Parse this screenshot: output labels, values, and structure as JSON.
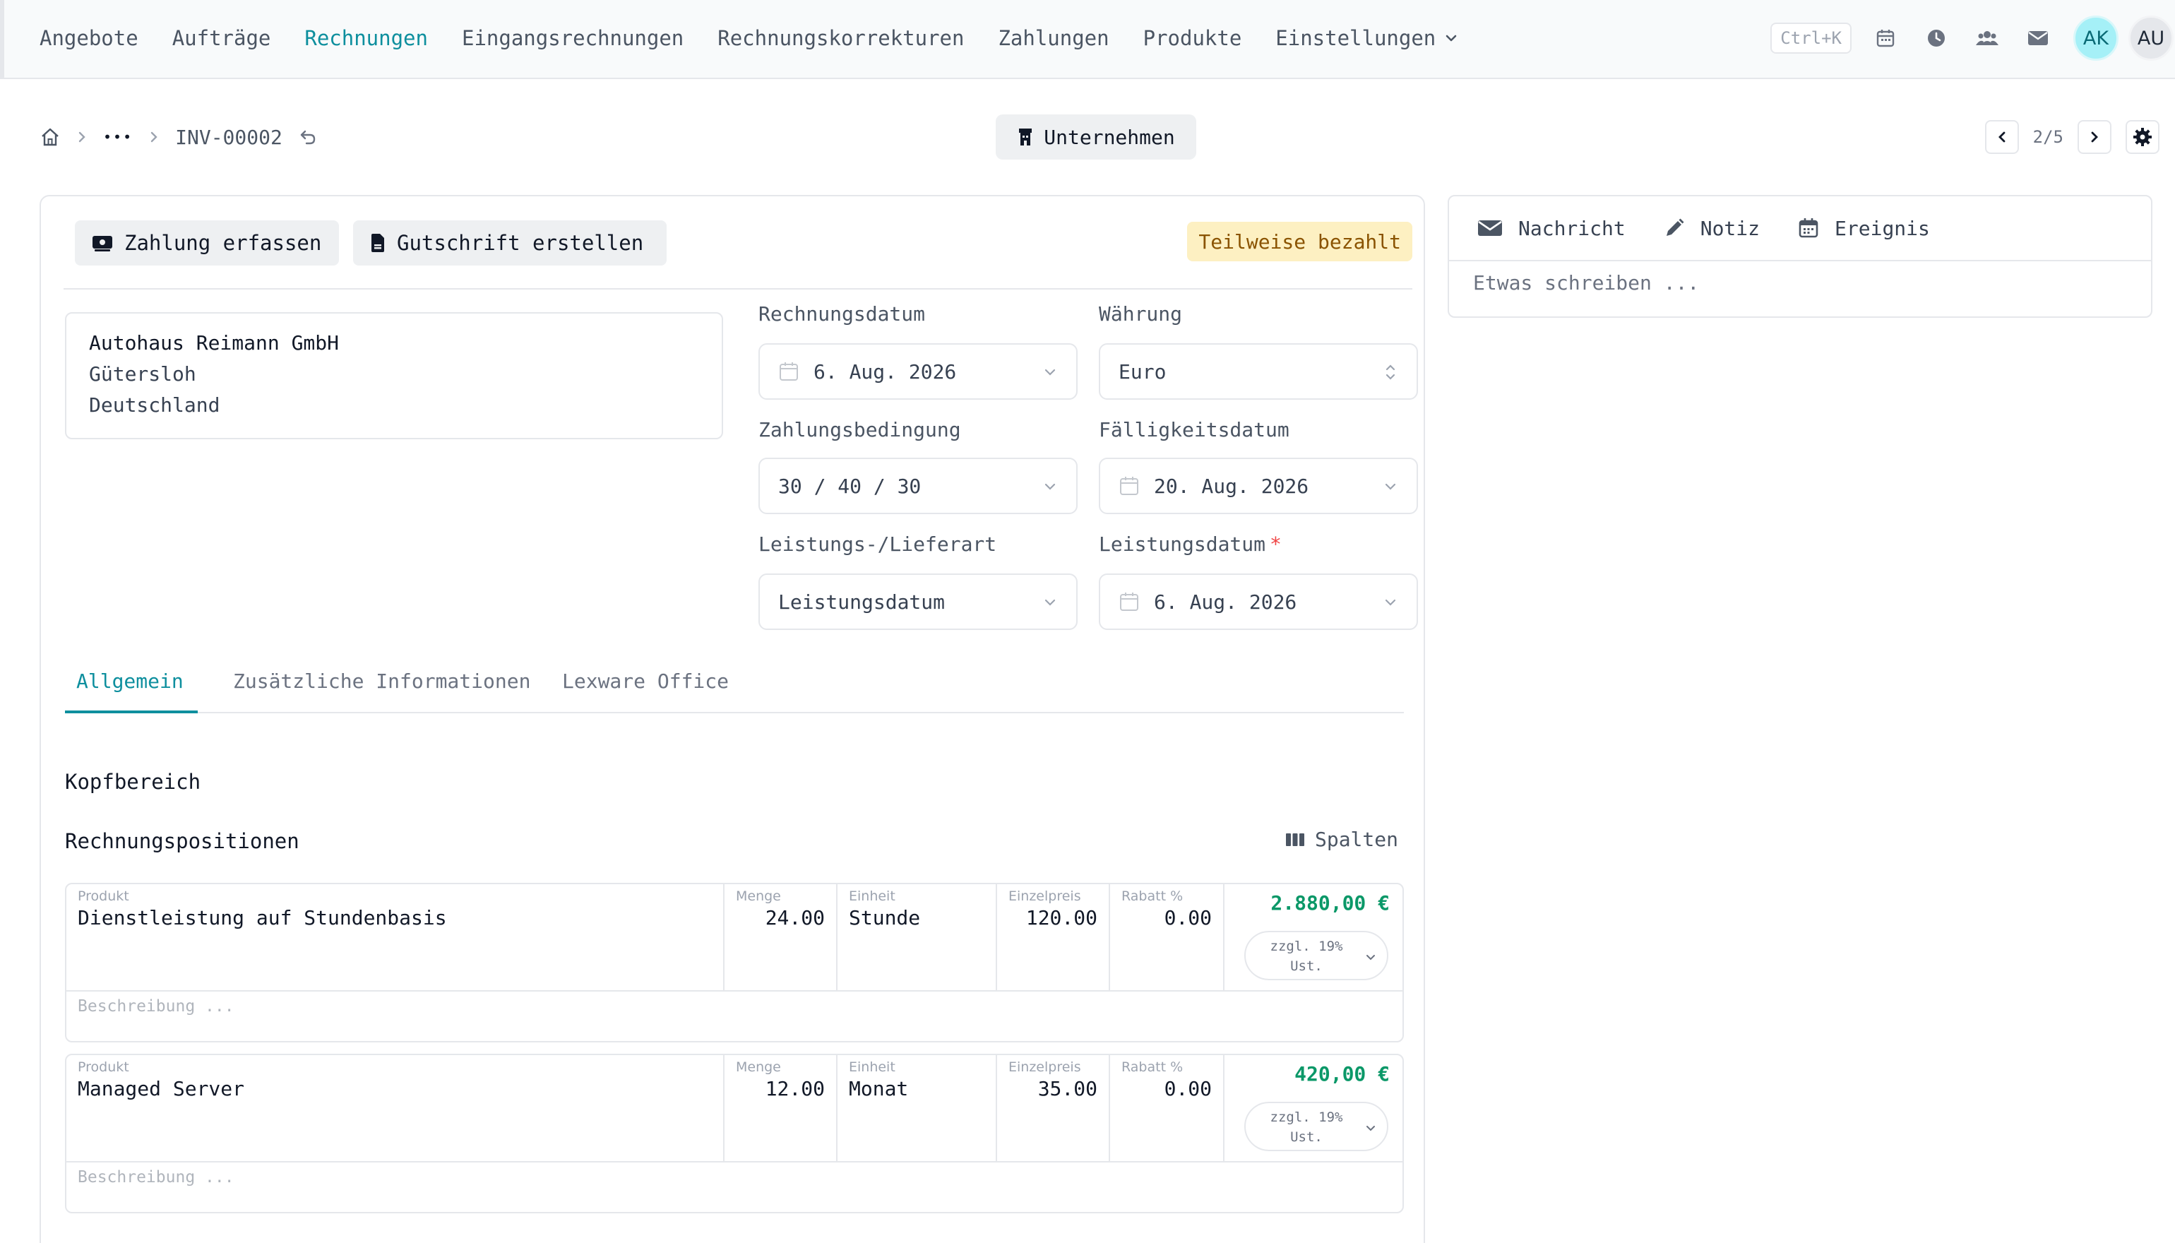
{
  "nav": {
    "items": [
      "Angebote",
      "Aufträge",
      "Rechnungen",
      "Eingangsrechnungen",
      "Rechnungskorrekturen",
      "Zahlungen",
      "Produkte",
      "Einstellungen"
    ],
    "active_index": 2,
    "shortcut": "Ctrl+K",
    "avatars": [
      "AK",
      "AU"
    ],
    "icons": [
      "calendar-icon",
      "clock-icon",
      "users-icon",
      "mail-icon"
    ]
  },
  "breadcrumb": {
    "ellipsis": "•••",
    "current": "INV-00002"
  },
  "company_button": {
    "label": "Unternehmen"
  },
  "pager": {
    "text": "2/5"
  },
  "actions": {
    "record_payment": "Zahlung erfassen",
    "create_credit": "Gutschrift erstellen",
    "status": "Teilweise bezahlt"
  },
  "address": {
    "name": "Autohaus Reimann GmbH",
    "city": "Gütersloh",
    "country": "Deutschland"
  },
  "fields": {
    "invoice_date_label": "Rechnungsdatum",
    "invoice_date": "6. Aug. 2026",
    "currency_label": "Währung",
    "currency": "Euro",
    "payment_terms_label": "Zahlungsbedingung",
    "payment_terms": "30 / 40 / 30",
    "due_date_label": "Fälligkeitsdatum",
    "due_date": "20. Aug. 2026",
    "delivery_type_label": "Leistungs-/Lieferart",
    "delivery_type": "Leistungsdatum",
    "service_date_label": "Leistungsdatum",
    "service_date_required": "*",
    "service_date": "6. Aug. 2026"
  },
  "tabs": [
    "Allgemein",
    "Zusätzliche Informationen",
    "Lexware Office"
  ],
  "sections": {
    "header": "Kopfbereich",
    "positions": "Rechnungspositionen",
    "columns_button": "Spalten"
  },
  "line_headers": {
    "product": "Produkt",
    "qty": "Menge",
    "unit": "Einheit",
    "price": "Einzelpreis",
    "discount": "Rabatt %"
  },
  "lines": [
    {
      "product": "Dienstleistung auf Stundenbasis",
      "qty": "24.00",
      "unit": "Stunde",
      "price": "120.00",
      "discount": "0.00",
      "amount": "2.880,00 €",
      "tax_line1": "zzgl. 19%",
      "tax_line2": "Ust.",
      "desc_placeholder": "Beschreibung ..."
    },
    {
      "product": "Managed Server",
      "qty": "12.00",
      "unit": "Monat",
      "price": "35.00",
      "discount": "0.00",
      "amount": "420,00 €",
      "tax_line1": "zzgl. 19%",
      "tax_line2": "Ust.",
      "desc_placeholder": "Beschreibung ..."
    }
  ],
  "side": {
    "tabs": [
      "Nachricht",
      "Notiz",
      "Ereignis"
    ],
    "placeholder": "Etwas schreiben ..."
  },
  "colors": {
    "accent": "#0e8f9e",
    "amount": "#0b9868",
    "status_bg": "#fdf0c2",
    "status_fg": "#8a5300"
  }
}
